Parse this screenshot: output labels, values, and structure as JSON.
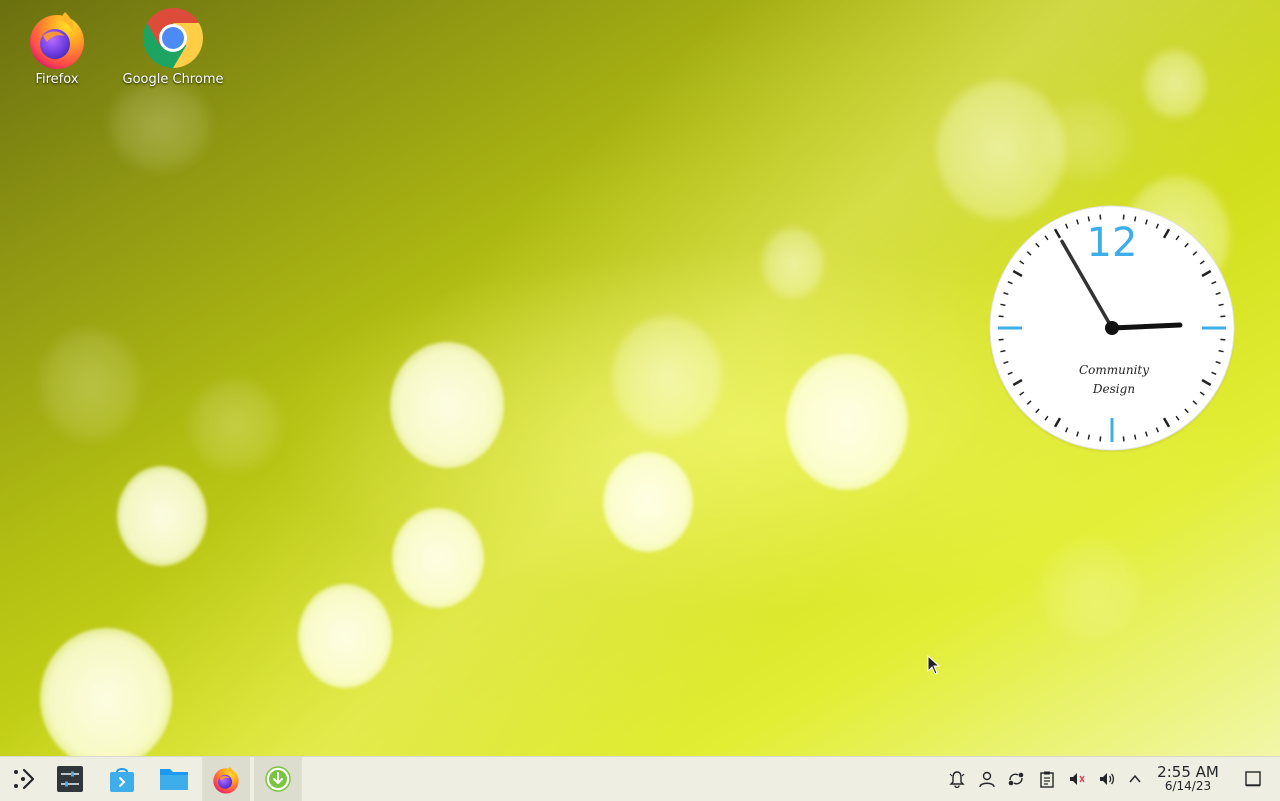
{
  "desktop": {
    "icons": [
      {
        "label": "Firefox",
        "icon": "firefox-icon"
      },
      {
        "label": "Google Chrome",
        "icon": "chrome-icon"
      }
    ],
    "wallpaper_colors": {
      "dark": "#6b7010",
      "mid": "#b2bf12",
      "bright": "#e2ee34"
    }
  },
  "clock_widget": {
    "numeral": "12",
    "caption_line1": "Community",
    "caption_line2": "Design",
    "time_shown": "2:55",
    "accent_color": "#3daee9"
  },
  "taskbar": {
    "launchers": [
      {
        "icon": "application-launcher-icon"
      },
      {
        "icon": "system-settings-icon"
      },
      {
        "icon": "discover-store-icon"
      },
      {
        "icon": "file-manager-icon"
      },
      {
        "icon": "firefox-icon"
      },
      {
        "icon": "update-download-icon"
      }
    ],
    "tray": [
      {
        "icon": "notifications-bell-icon"
      },
      {
        "icon": "user-icon"
      },
      {
        "icon": "kde-connect-icon"
      },
      {
        "icon": "clipboard-icon"
      },
      {
        "icon": "audio-muted-icon"
      },
      {
        "icon": "volume-icon"
      },
      {
        "icon": "chevron-up-icon"
      }
    ],
    "time": "2:55 AM",
    "date": "6/14/23",
    "show_desktop_icon": "show-desktop-icon"
  }
}
